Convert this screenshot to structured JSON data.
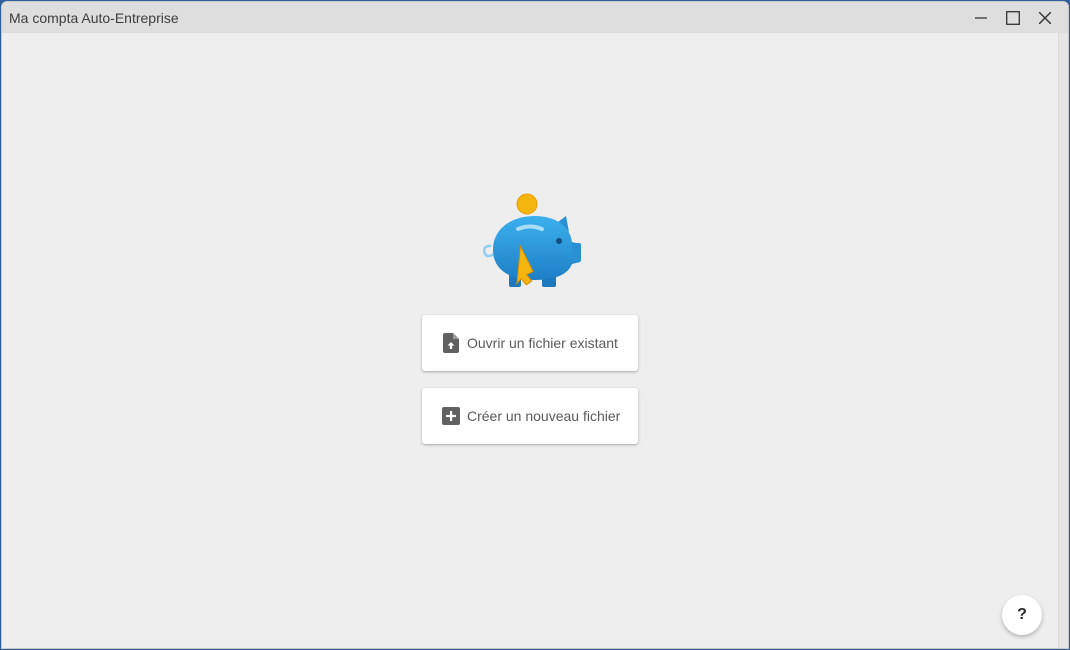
{
  "window": {
    "title": "Ma compta Auto-Entreprise",
    "controls": {
      "minimize_icon": "minimize-icon",
      "maximize_icon": "maximize-icon",
      "close_icon": "close-icon"
    }
  },
  "main": {
    "logo_icon": "piggy-bank-coin-cursor-icon",
    "buttons": {
      "open": {
        "label": "Ouvrir un fichier existant",
        "icon": "file-upload-icon"
      },
      "create": {
        "label": "Créer un nouveau fichier",
        "icon": "plus-box-icon"
      }
    },
    "help": {
      "label": "?"
    }
  },
  "colors": {
    "background": "#eeeeee",
    "titlebar": "#dedede",
    "piggy_blue": "#2f9ee0",
    "coin_yellow": "#f5b50f",
    "icon_gray": "#616161"
  }
}
